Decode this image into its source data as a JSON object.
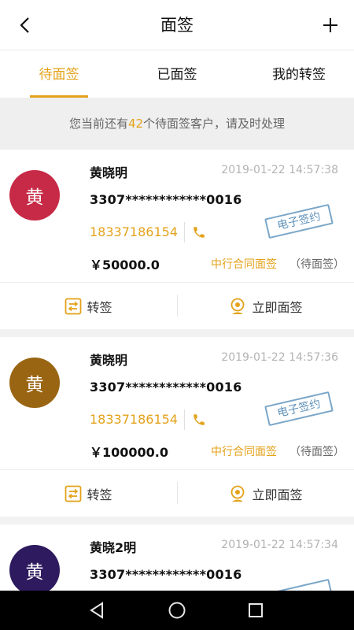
{
  "header": {
    "title": "面签",
    "back_icon": "chevron-left-icon",
    "add_icon": "plus-icon"
  },
  "tabs": [
    {
      "label": "待面签",
      "active": true
    },
    {
      "label": "已面签",
      "active": false
    },
    {
      "label": "我的转签",
      "active": false
    }
  ],
  "notice": {
    "prefix": "您当前还有",
    "count": "42",
    "suffix": "个待面签客户，请及时处理"
  },
  "colors": {
    "accent": "#e3a21a",
    "stamp": "#5f92bb"
  },
  "cards": [
    {
      "avatar_char": "黄",
      "avatar_color": "#c72a46",
      "name": "黄晓明",
      "time": "2019-01-22 14:57:38",
      "id_number": "3307************0016",
      "phone": "18337186154",
      "stamp": "电子签约",
      "amount": "￥50000.0",
      "contract_type": "中行合同面签",
      "status": "（待面签）",
      "action_transfer": "转签",
      "action_sign": "立即面签"
    },
    {
      "avatar_char": "黄",
      "avatar_color": "#9a6512",
      "name": "黄晓明",
      "time": "2019-01-22 14:57:36",
      "id_number": "3307************0016",
      "phone": "18337186154",
      "stamp": "电子签约",
      "amount": "￥100000.0",
      "contract_type": "中行合同面签",
      "status": "（待面签）",
      "action_transfer": "转签",
      "action_sign": "立即面签"
    },
    {
      "avatar_char": "黄",
      "avatar_color": "#2e1a5e",
      "name": "黄晓2明",
      "time": "2019-01-22 14:57:34",
      "id_number": "3307************0016"
    }
  ],
  "system_nav": {
    "back": "triangle-back-icon",
    "home": "circle-home-icon",
    "recents": "square-recents-icon"
  }
}
